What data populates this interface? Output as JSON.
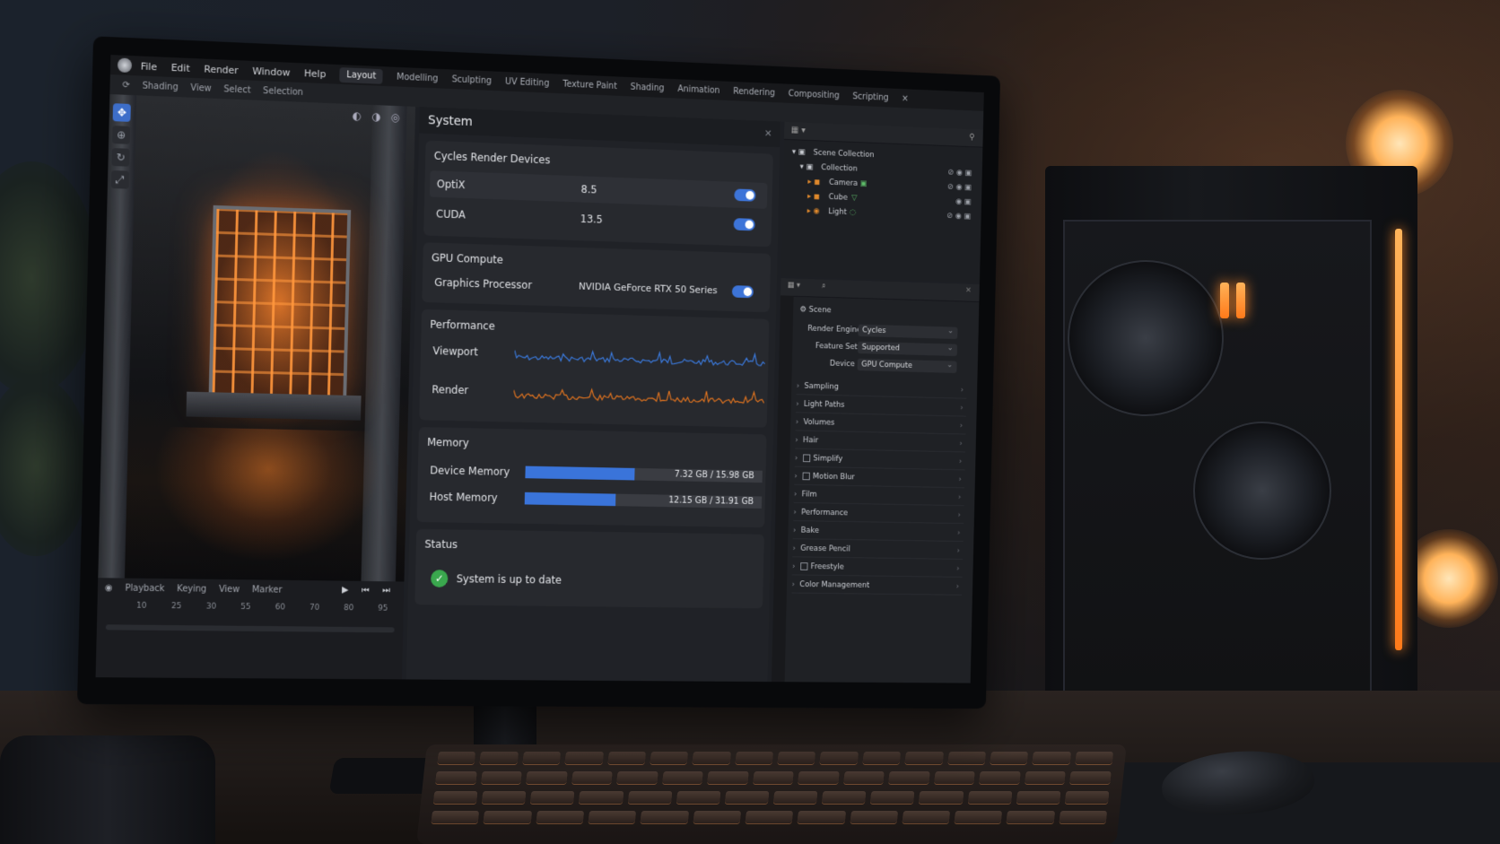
{
  "menubar": {
    "menus": [
      "File",
      "Edit",
      "Render",
      "Window",
      "Help"
    ],
    "workspaces": [
      "Layout",
      "Modelling",
      "Sculpting",
      "UV Editing",
      "Texture Paint",
      "Shading",
      "Animation",
      "Rendering",
      "Compositing",
      "Scripting"
    ],
    "active_workspace": "Layout"
  },
  "toolbar": {
    "items": [
      "Shading",
      "View",
      "Select",
      "Selection"
    ]
  },
  "timeline": {
    "menus": [
      "Playback",
      "Keying",
      "View",
      "Marker"
    ],
    "ticks": [
      "10",
      "25",
      "30",
      "55",
      "60",
      "70",
      "80",
      "95"
    ]
  },
  "system": {
    "title": "System",
    "cycles": {
      "title": "Cycles Render Devices",
      "devices": [
        {
          "name": "OptiX",
          "version": "8.5",
          "enabled": true
        },
        {
          "name": "CUDA",
          "version": "13.5",
          "enabled": true
        }
      ]
    },
    "gpu": {
      "title": "GPU Compute",
      "label": "Graphics Processor",
      "value": "NVIDIA GeForce RTX 50 Series",
      "enabled": true
    },
    "performance": {
      "title": "Performance",
      "viewport_label": "Viewport",
      "render_label": "Render",
      "viewport_color": "#3b7be0",
      "render_color": "#e0731f"
    },
    "memory": {
      "title": "Memory",
      "device": {
        "label": "Device Memory",
        "text": "7.32 GB / 15.98 GB",
        "fraction": 0.458
      },
      "host": {
        "label": "Host Memory",
        "text": "12.15 GB / 31.91 GB",
        "fraction": 0.381
      }
    },
    "status": {
      "title": "Status",
      "message": "System is up to date"
    }
  },
  "outliner": {
    "root": "Scene Collection",
    "collection": "Collection",
    "objects": [
      "Camera",
      "Cube",
      "Light"
    ]
  },
  "properties": {
    "context": "Scene",
    "render_engine": {
      "label": "Render Engine",
      "value": "Cycles"
    },
    "feature_set": {
      "label": "Feature Set",
      "value": "Supported"
    },
    "device": {
      "label": "Device",
      "value": "GPU Compute"
    },
    "sections": [
      {
        "label": "Sampling",
        "checkbox": false
      },
      {
        "label": "Light Paths",
        "checkbox": false
      },
      {
        "label": "Volumes",
        "checkbox": false
      },
      {
        "label": "Hair",
        "checkbox": false
      },
      {
        "label": "Simplify",
        "checkbox": true
      },
      {
        "label": "Motion Blur",
        "checkbox": true
      },
      {
        "label": "Film",
        "checkbox": false
      },
      {
        "label": "Performance",
        "checkbox": false
      },
      {
        "label": "Bake",
        "checkbox": false
      },
      {
        "label": "Grease Pencil",
        "checkbox": false
      },
      {
        "label": "Freestyle",
        "checkbox": true
      },
      {
        "label": "Color Management",
        "checkbox": false
      }
    ]
  },
  "colors": {
    "accent": "#3a74da",
    "status_ok": "#3aa84e"
  }
}
